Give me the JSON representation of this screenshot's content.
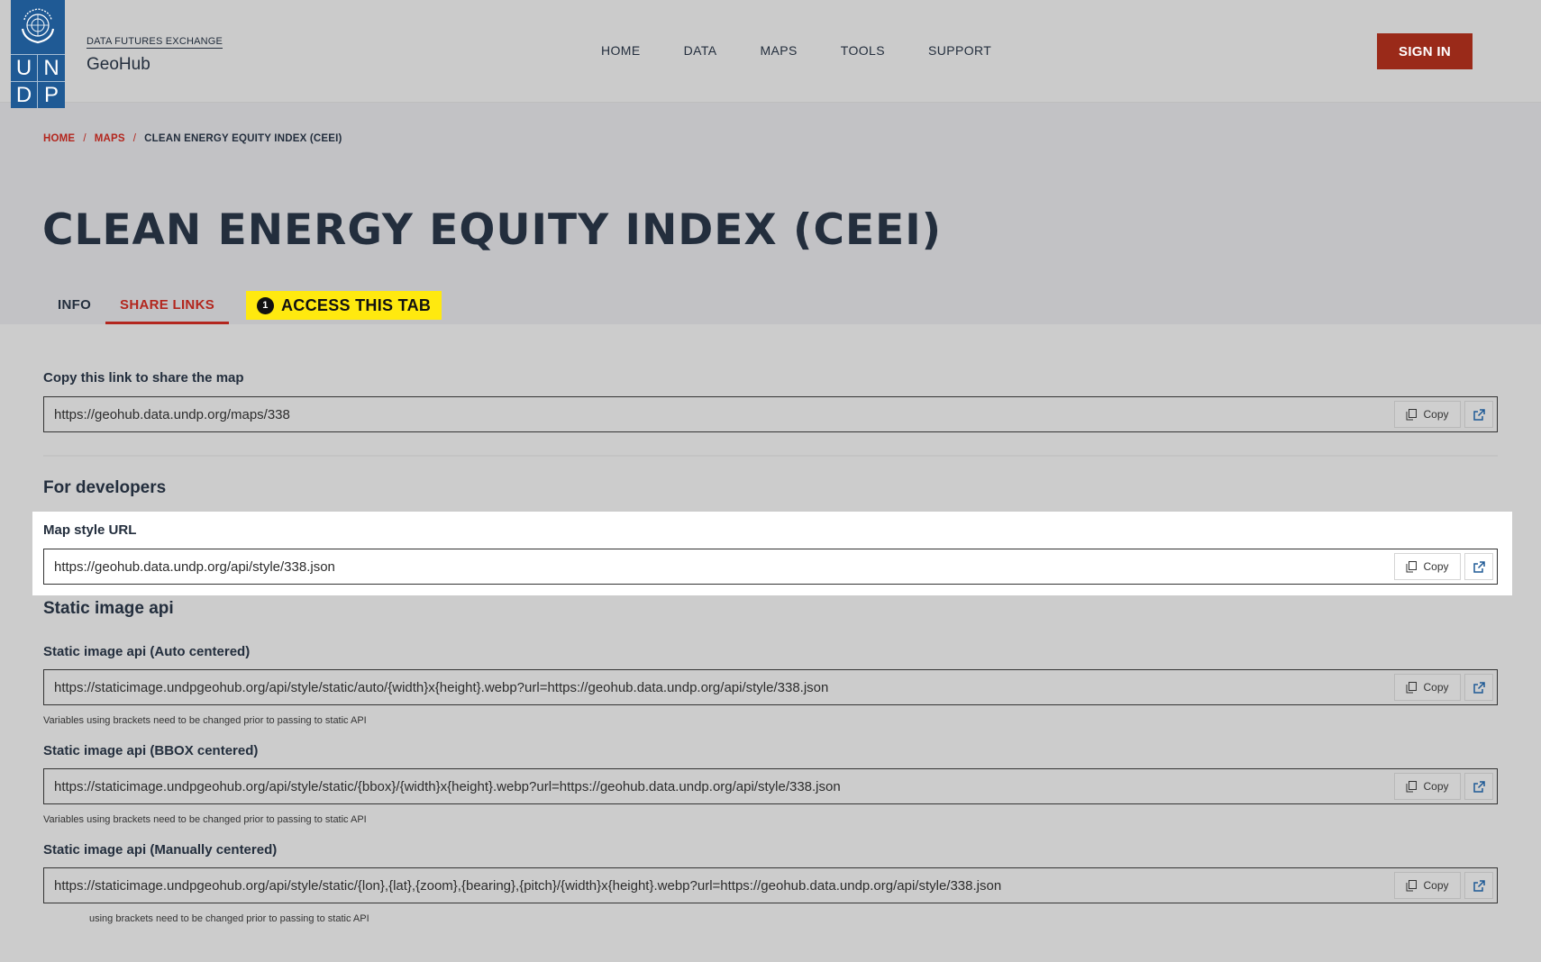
{
  "header": {
    "org_super": "DATA FUTURES EXCHANGE",
    "app_name": "GeoHub",
    "logo_letters": [
      "U",
      "N",
      "D",
      "P"
    ],
    "nav": [
      "HOME",
      "DATA",
      "MAPS",
      "TOOLS",
      "SUPPORT"
    ],
    "signin_label": "SIGN IN"
  },
  "breadcrumb": [
    "HOME",
    "MAPS",
    "CLEAN ENERGY EQUITY INDEX (CEEI)"
  ],
  "breadcrumb_separator": "/",
  "page_title": "CLEAN ENERGY EQUITY INDEX (CEEI)",
  "tabs": [
    {
      "label": "INFO",
      "active": false
    },
    {
      "label": "SHARE LINKS",
      "active": true
    }
  ],
  "callout": {
    "number": "1",
    "text": "ACCESS THIS TAB",
    "color": "#ffe90f"
  },
  "share": {
    "label": "Copy this link to share the map",
    "url": "https://geohub.data.undp.org/maps/338"
  },
  "developers": {
    "title": "For developers",
    "style_label": "Map style URL",
    "style_url": "https://geohub.data.undp.org/api/style/338.json"
  },
  "static_api": {
    "title": "Static image api",
    "items": [
      {
        "label": "Static image api (Auto centered)",
        "url": "https://staticimage.undpgeohub.org/api/style/static/auto/{width}x{height}.webp?url=https://geohub.data.undp.org/api/style/338.json",
        "hint": "Variables using brackets need to be changed prior to passing to static API"
      },
      {
        "label": "Static image api (BBOX centered)",
        "url": "https://staticimage.undpgeohub.org/api/style/static/{bbox}/{width}x{height}.webp?url=https://geohub.data.undp.org/api/style/338.json",
        "hint": "Variables using brackets need to be changed prior to passing to static API"
      },
      {
        "label": "Static image api (Manually centered)",
        "url": "https://staticimage.undpgeohub.org/api/style/static/{lon},{lat},{zoom},{bearing},{pitch}/{width}x{height}.webp?url=https://geohub.data.undp.org/api/style/338.json",
        "hint": "using brackets need to be changed prior to passing to static API"
      }
    ]
  },
  "copy_label": "Copy",
  "icons": {
    "copy": "copy-icon",
    "open": "external-link-icon"
  },
  "colors": {
    "brand_red": "#9a2a19",
    "undp_blue": "#1f5a95",
    "link_red": "#b3261e"
  }
}
